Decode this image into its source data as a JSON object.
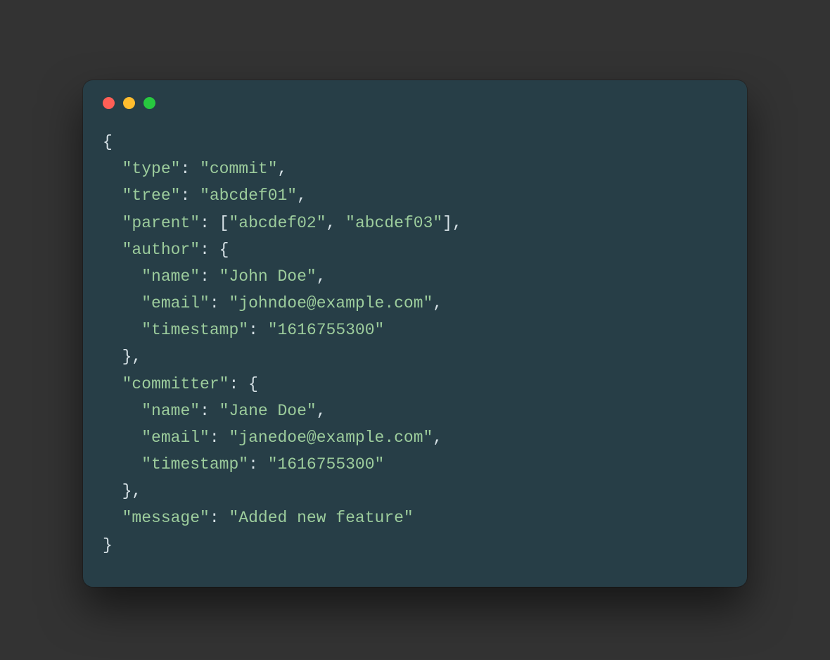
{
  "colors": {
    "page_bg": "#333333",
    "window_bg": "#273e47",
    "key_color": "#9CCC9C",
    "string_color": "#9CCC9C",
    "punct_color": "#d6e1e6",
    "traffic_red": "#ff5f56",
    "traffic_yellow": "#ffbd2e",
    "traffic_green": "#27c93f"
  },
  "code": {
    "type_key": "type",
    "type_val": "commit",
    "tree_key": "tree",
    "tree_val": "abcdef01",
    "parent_key": "parent",
    "parent_vals": [
      "abcdef02",
      "abcdef03"
    ],
    "author_key": "author",
    "author": {
      "name_key": "name",
      "name_val": "John Doe",
      "email_key": "email",
      "email_val": "johndoe@example.com",
      "timestamp_key": "timestamp",
      "timestamp_val": "1616755300"
    },
    "committer_key": "committer",
    "committer": {
      "name_key": "name",
      "name_val": "Jane Doe",
      "email_key": "email",
      "email_val": "janedoe@example.com",
      "timestamp_key": "timestamp",
      "timestamp_val": "1616755300"
    },
    "message_key": "message",
    "message_val": "Added new feature"
  }
}
